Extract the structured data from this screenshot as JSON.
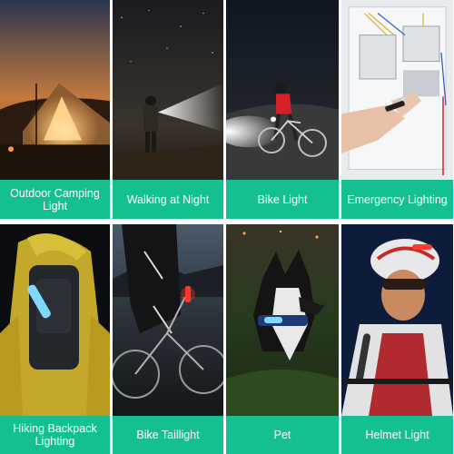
{
  "scenes": [
    {
      "caption": "Outdoor Camping Light",
      "icon": "camping-tent-scene"
    },
    {
      "caption": "Walking at Night",
      "icon": "night-walk-scene"
    },
    {
      "caption": "Bike Light",
      "icon": "bike-front-light-scene"
    },
    {
      "caption": "Emergency Lighting",
      "icon": "electrical-panel-scene"
    },
    {
      "caption": "Hiking Backpack Lighting",
      "icon": "hiker-backpack-scene"
    },
    {
      "caption": "Bike Taillight",
      "icon": "bike-taillight-scene"
    },
    {
      "caption": "Pet",
      "icon": "dog-collar-light-scene"
    },
    {
      "caption": "Helmet Light",
      "icon": "helmet-cyclist-scene"
    }
  ],
  "colors": {
    "caption_bg": "#14c08f",
    "caption_text": "#ffffff",
    "led_blue": "#7fd8ff",
    "led_red": "#ff3a2a"
  }
}
